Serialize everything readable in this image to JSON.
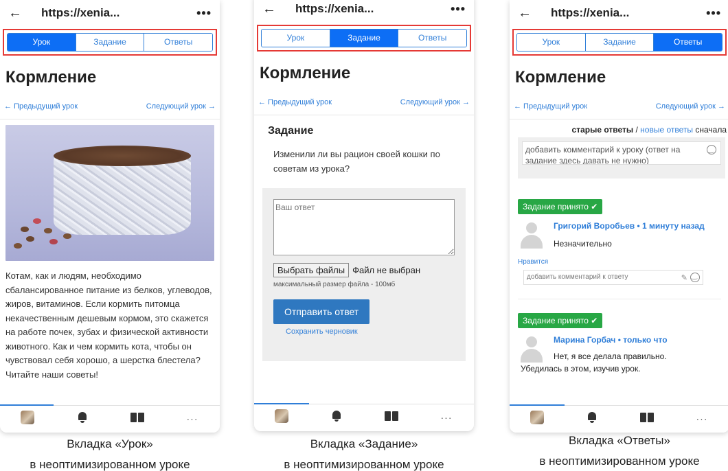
{
  "url": "https://xenia...",
  "tabs": [
    "Урок",
    "Задание",
    "Ответы"
  ],
  "lesson_title": "Кормление",
  "prev_link": "← Предыдущий урок",
  "next_link": "Следующий урок →",
  "lesson": {
    "text": "Котам, как и людям, необходимо сбалансированное питание из белков, углеводов, жиров, витаминов. Если кормить питомца некачественным дешевым кормом, это скажется на работе почек, зубах и физической активности животного. Как и чем кормить кота, чтобы он чувствовал себя хорошо, а шерстка блестела? Читайте наши советы!"
  },
  "task": {
    "heading": "Задание",
    "question": "Изменили ли вы рацион своей кошки по советам из урока?",
    "answer_placeholder": "Ваш ответ",
    "choose_files": "Выбрать файлы",
    "no_file": "Файл не выбран",
    "max_size": "максимальный размер файла - 100мб",
    "submit": "Отправить ответ",
    "save_draft": "Сохранить черновик"
  },
  "answers": {
    "sort_old": "старые ответы",
    "sort_sep": "/",
    "sort_new": "новые ответы",
    "sort_first": "сначала",
    "lesson_comment_placeholder": "добавить комментарий к уроку (ответ на задание здесь давать не нужно)",
    "items": [
      {
        "badge": "Задание принято ✔",
        "author": "Григорий Воробьев • 1 минуту назад",
        "text": "Незначительно",
        "like": "Нравится",
        "reply_placeholder": "добавить комментарий к ответу"
      },
      {
        "badge": "Задание принято ✔",
        "author": "Марина Горбач • только что",
        "text": "Нет, я все делала правильно.",
        "text2": "Убедилась в этом, изучив урок."
      }
    ]
  },
  "bottom_nav": [
    "avatar-icon",
    "bell-icon",
    "book-icon",
    "dots-icon"
  ],
  "bottom_nav_more": "···",
  "captions": [
    {
      "line1": "Вкладка «Урок»",
      "line2": "в неоптимизированном уроке"
    },
    {
      "line1": "Вкладка «Задание»",
      "line2": "в неоптимизированном уроке"
    },
    {
      "line1": "Вкладка «Ответы»",
      "line2": "в неоптимизированном уроке"
    }
  ],
  "colors": {
    "accent": "#0d6ef5",
    "link": "#2f7ed8",
    "highlight": "#e53935",
    "accepted": "#28a745",
    "submit": "#2f78c0"
  }
}
